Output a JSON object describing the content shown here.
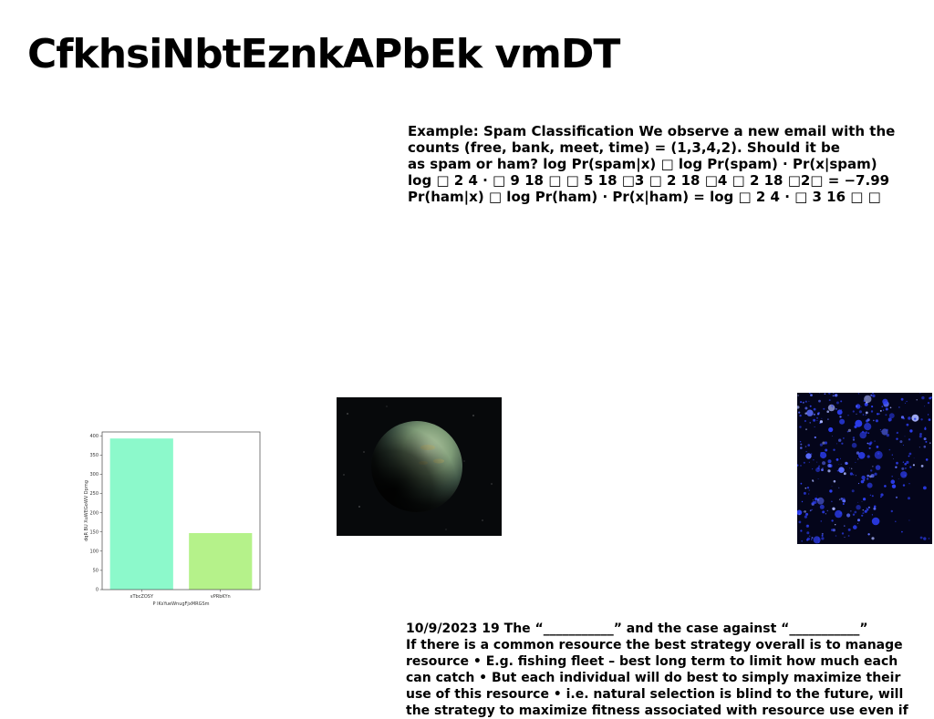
{
  "title": "CfkhsiNbtEznkAPbEk vmDT",
  "spam_block": {
    "lines": [
      "Example: Spam Classification We observe a new email with the",
      "counts (free, bank, meet, time) = (1,3,4,2). Should it be",
      "as spam or ham? log Pr(spam|x) □ log Pr(spam) · Pr(x|spam)",
      "log □ 2 4 · □ 9 18 □ □ 5 18 □3 □ 2 18 □4 □ 2 18 □2□ = −7.99",
      "Pr(ham|x) □ log Pr(ham) · Pr(x|ham) = log □ 2 4 · □ 3 16 □ □"
    ]
  },
  "common_block": {
    "lines": [
      "10/9/2023 19 The “___________” and the case against “___________”",
      "If there is a common resource the best strategy overall is to manage",
      "resource • E.g. fishing fleet – best long term to limit how much each",
      "can catch • But each individual will do best to simply maximize their",
      "use of this resource • i.e. natural selection is blind to the future, will",
      "the strategy to maximize fitness associated with resource use even if"
    ]
  },
  "images": {
    "planet": "planet-in-space",
    "blue": "blue-particles"
  },
  "chart_data": {
    "type": "bar",
    "categories": [
      "xTbcZOSY",
      "vPRbKYn"
    ],
    "values": [
      393,
      147
    ],
    "colors": [
      "#8cf9cb",
      "#b5f28a"
    ],
    "xlabel": "P lKsYueWnugFjxMRGSm",
    "ylabel": "dqR BU XuWEGoWV Dpmg",
    "ylim": [
      0,
      410
    ],
    "yticks": [
      0,
      50,
      100,
      150,
      200,
      250,
      300,
      350,
      400
    ],
    "grid": false
  }
}
